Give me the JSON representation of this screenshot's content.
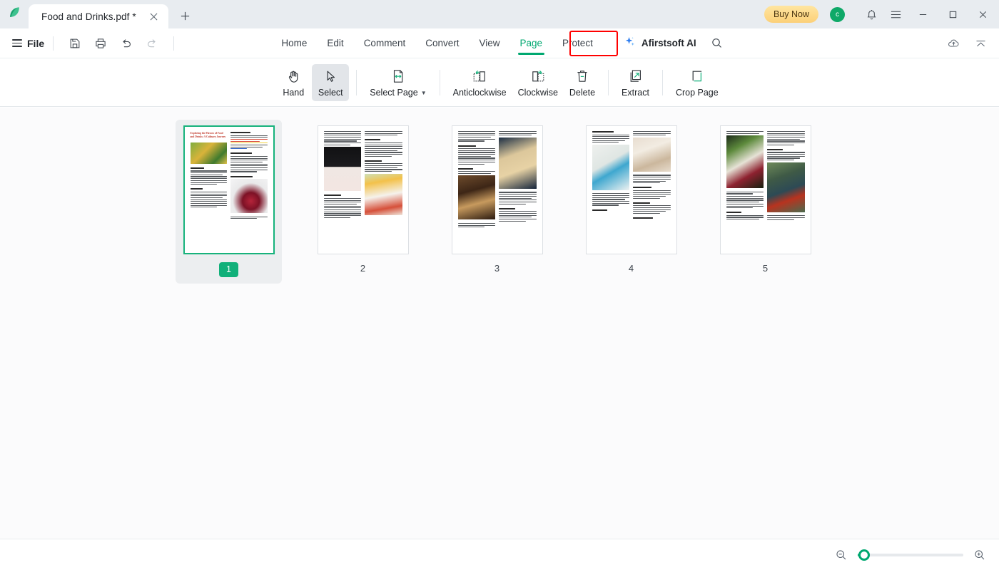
{
  "titlebar": {
    "logo_icon": "leaf-logo-icon",
    "tab_title": "Food and Drinks.pdf *",
    "close_icon": "close-icon",
    "new_tab_icon": "plus-icon",
    "buy_now_label": "Buy Now",
    "avatar_initial": "c",
    "notification_icon": "bell-icon",
    "menu_icon": "hamburger-menu-icon",
    "minimize_icon": "minimize-icon",
    "maximize_icon": "maximize-icon",
    "window_close_icon": "window-close-icon"
  },
  "menubar": {
    "file_label": "File",
    "quick_actions": [
      {
        "name": "save-icon",
        "disabled": false
      },
      {
        "name": "print-icon",
        "disabled": false
      },
      {
        "name": "undo-icon",
        "disabled": false
      },
      {
        "name": "redo-icon",
        "disabled": true
      }
    ],
    "tabs": [
      {
        "label": "Home",
        "active": false
      },
      {
        "label": "Edit",
        "active": false
      },
      {
        "label": "Comment",
        "active": false
      },
      {
        "label": "Convert",
        "active": false
      },
      {
        "label": "View",
        "active": false
      },
      {
        "label": "Page",
        "active": true
      },
      {
        "label": "Protect",
        "active": false
      }
    ],
    "ai_label": "Afirstsoft AI",
    "ai_icon": "sparkle-icon",
    "search_icon": "search-icon",
    "cloud_icon": "cloud-upload-icon",
    "collapse_icon": "collapse-ribbon-icon",
    "accent_color": "#00a870",
    "annotation_color": "#ff0000"
  },
  "ribbon": {
    "buttons": [
      {
        "label": "Hand",
        "icon": "hand-icon",
        "active": false,
        "caret": false
      },
      {
        "label": "Select",
        "icon": "cursor-arrow-icon",
        "active": true,
        "caret": false
      },
      {
        "label": "Select Page",
        "icon": "select-page-icon",
        "active": false,
        "caret": true
      },
      {
        "label": "Anticlockwise",
        "icon": "rotate-anticlockwise-icon",
        "active": false,
        "caret": false
      },
      {
        "label": "Clockwise",
        "icon": "rotate-clockwise-icon",
        "active": false,
        "caret": false
      },
      {
        "label": "Delete",
        "icon": "trash-icon",
        "active": false,
        "caret": false
      },
      {
        "label": "Extract",
        "icon": "extract-pages-icon",
        "active": false,
        "caret": false
      },
      {
        "label": "Crop Page",
        "icon": "crop-page-icon",
        "active": false,
        "caret": false
      }
    ]
  },
  "pages": [
    {
      "number": "1",
      "selected": true,
      "title": "Exploring the Flavors of Food and Drinks: A Culinary Journey"
    },
    {
      "number": "2",
      "selected": false,
      "title": ""
    },
    {
      "number": "3",
      "selected": false,
      "title": ""
    },
    {
      "number": "4",
      "selected": false,
      "title": ""
    },
    {
      "number": "5",
      "selected": false,
      "title": ""
    }
  ],
  "statusbar": {
    "zoom_out_icon": "zoom-out-icon",
    "zoom_in_icon": "zoom-in-icon",
    "zoom_slider_percent": 6
  }
}
